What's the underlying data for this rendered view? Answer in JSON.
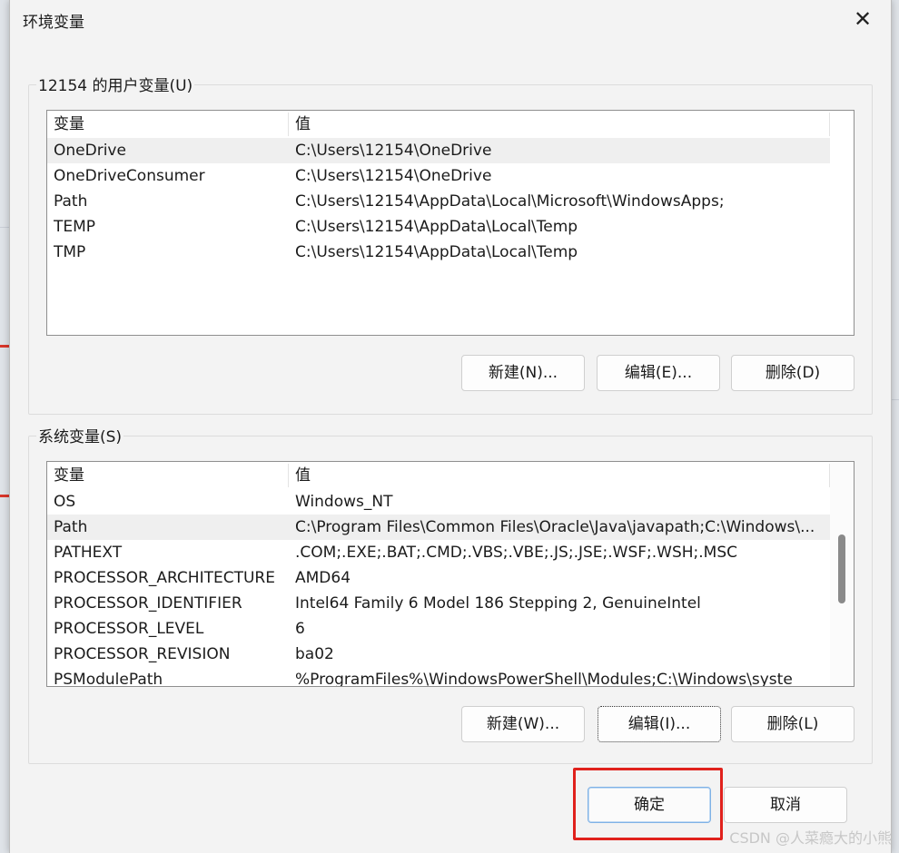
{
  "window": {
    "title": "环境变量",
    "close_glyph": "✕"
  },
  "user_vars": {
    "group_label": "12154 的用户变量(U)",
    "columns": [
      "变量",
      "值"
    ],
    "rows": [
      {
        "name": "OneDrive",
        "value": "C:\\Users\\12154\\OneDrive"
      },
      {
        "name": "OneDriveConsumer",
        "value": "C:\\Users\\12154\\OneDrive"
      },
      {
        "name": "Path",
        "value": "C:\\Users\\12154\\AppData\\Local\\Microsoft\\WindowsApps;"
      },
      {
        "name": "TEMP",
        "value": "C:\\Users\\12154\\AppData\\Local\\Temp"
      },
      {
        "name": "TMP",
        "value": "C:\\Users\\12154\\AppData\\Local\\Temp"
      }
    ],
    "buttons": {
      "new": "新建(N)...",
      "edit": "编辑(E)...",
      "delete": "删除(D)"
    }
  },
  "system_vars": {
    "group_label": "系统变量(S)",
    "columns": [
      "变量",
      "值"
    ],
    "rows": [
      {
        "name": "OS",
        "value": "Windows_NT"
      },
      {
        "name": "Path",
        "value": "C:\\Program Files\\Common Files\\Oracle\\Java\\javapath;C:\\Windows\\..."
      },
      {
        "name": "PATHEXT",
        "value": ".COM;.EXE;.BAT;.CMD;.VBS;.VBE;.JS;.JSE;.WSF;.WSH;.MSC"
      },
      {
        "name": "PROCESSOR_ARCHITECTURE",
        "value": "AMD64"
      },
      {
        "name": "PROCESSOR_IDENTIFIER",
        "value": "Intel64 Family 6 Model 186 Stepping 2, GenuineIntel"
      },
      {
        "name": "PROCESSOR_LEVEL",
        "value": "6"
      },
      {
        "name": "PROCESSOR_REVISION",
        "value": "ba02"
      },
      {
        "name": "PSModulePath",
        "value": "%ProgramFiles%\\WindowsPowerShell\\Modules;C:\\Windows\\syste"
      }
    ],
    "buttons": {
      "new": "新建(W)...",
      "edit": "编辑(I)...",
      "delete": "删除(L)"
    }
  },
  "footer": {
    "ok": "确定",
    "cancel": "取消"
  },
  "watermark": "CSDN @人菜瘾大的小熊",
  "colors": {
    "highlight": "#e0211c",
    "primary_border": "#7fb2e6"
  }
}
